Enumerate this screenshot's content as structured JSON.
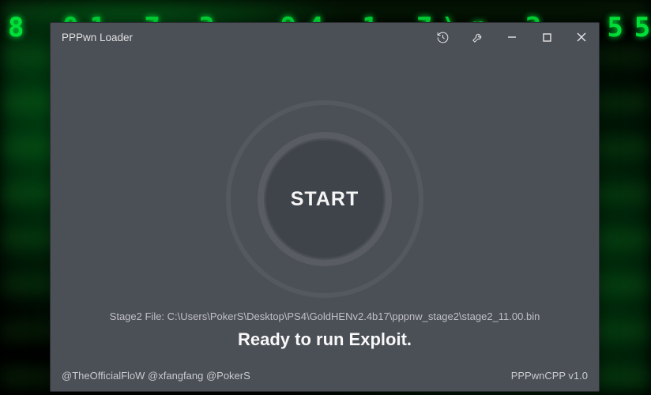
{
  "window": {
    "title": "PPPwn Loader"
  },
  "start": {
    "label": "START"
  },
  "status": {
    "stage2_prefix": "Stage2 File: ",
    "stage2_path": "C:\\Users\\PokerS\\Desktop\\PS4\\GoldHENv2.4b17\\pppnw_stage2\\stage2_11.00.bin",
    "ready": "Ready to run Exploit."
  },
  "footer": {
    "credits": "@TheOfficialFloW @xfangfang @PokerS",
    "version": "PPPwnCPP v1.0"
  }
}
